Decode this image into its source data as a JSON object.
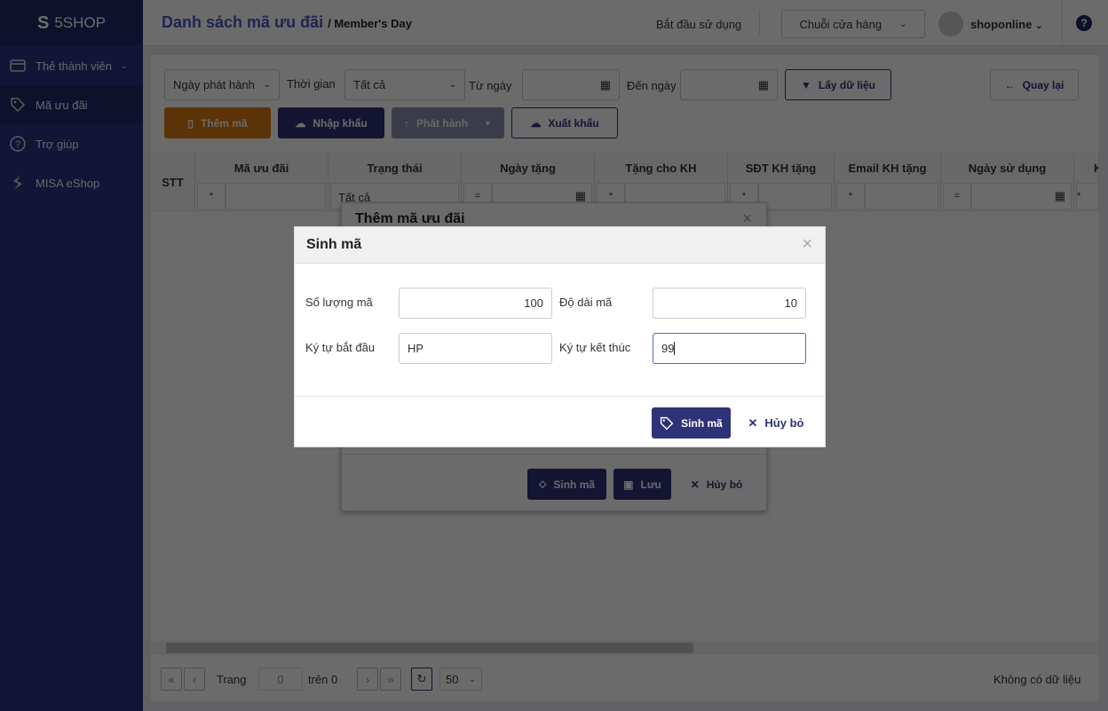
{
  "sidebar": {
    "logo": "5SHOP",
    "items": [
      {
        "label": "Thẻ thành viên"
      },
      {
        "label": "Mã ưu đãi"
      },
      {
        "label": "Trợ giúp"
      },
      {
        "label": "MISA eShop"
      }
    ]
  },
  "header": {
    "title": "Danh sách mã ưu đãi",
    "sub": "/ Member's Day",
    "start": "Bắt đầu sử dụng",
    "chain": "Chuỗi cửa hàng",
    "user": "shoponline",
    "help": "?"
  },
  "filters": {
    "date_type": "Ngày phát hành",
    "time_label": "Thời gian",
    "time_value": "Tất cả",
    "from_label": "Từ ngày",
    "to_label": "Đến ngày",
    "get_data": "Lấy dữ liệu",
    "back": "Quay lại"
  },
  "toolbar": {
    "add": "Thêm mã",
    "import": "Nhập khẩu",
    "issue": "Phát hành",
    "export": "Xuất khẩu"
  },
  "table": {
    "columns": [
      "STT",
      "Mã ưu đãi",
      "Trạng thái",
      "Ngày tặng",
      "Tặng cho KH",
      "SĐT KH tặng",
      "Email KH tặng",
      "Ngày sử dụng",
      "K"
    ],
    "status_filter": "Tất cả",
    "op_contains": "*",
    "op_equals": "="
  },
  "footer": {
    "page_label": "Trang",
    "page_value": "0",
    "of_label": "trên 0",
    "page_size": "50",
    "no_data": "Không có dữ liệu"
  },
  "add_dialog": {
    "title": "Thêm mã ưu đãi",
    "generate": "Sinh mã",
    "save": "Lưu",
    "cancel": "Hủy bỏ"
  },
  "gen_dialog": {
    "title": "Sinh mã",
    "qty_label": "Số lượng mã",
    "qty_value": "100",
    "len_label": "Độ dài mã",
    "len_value": "10",
    "prefix_label": "Ký tự bắt đầu",
    "prefix_value": "HP",
    "suffix_label": "Ký tự kết thúc",
    "suffix_value": "99",
    "generate": "Sinh mã",
    "cancel": "Hủy bỏ"
  },
  "colors": {
    "primary": "#2e3276",
    "orange": "#d9790f",
    "sidebar": "#1f2766",
    "title": "#4b55c2"
  }
}
